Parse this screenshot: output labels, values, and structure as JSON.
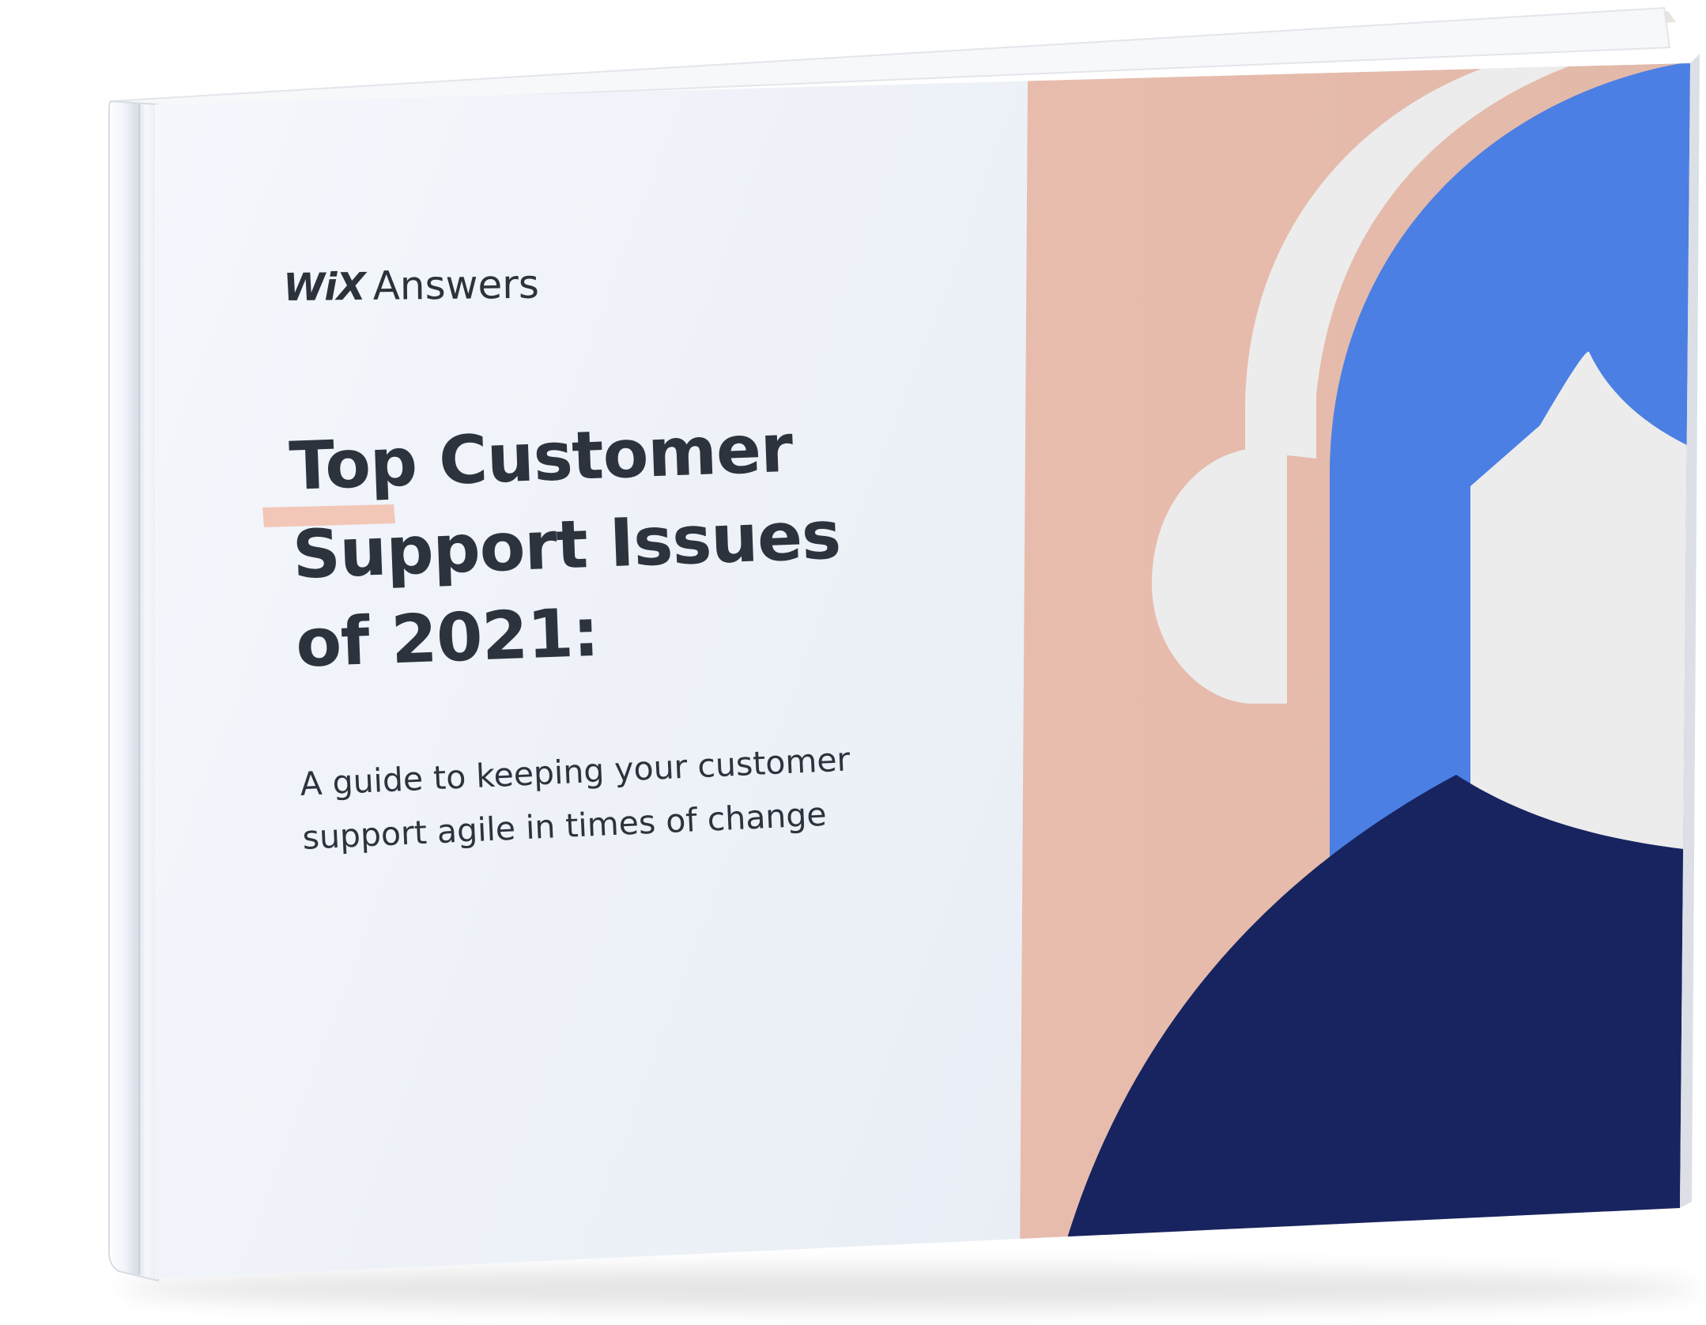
{
  "book": {
    "logo_brand": "WiX",
    "logo_product": "Answers",
    "title_lines": [
      "Top Customer",
      "Support Issues",
      "of 2021:"
    ],
    "subtitle_lines": [
      "A guide to keeping your customer",
      "support agile in times of change"
    ]
  },
  "colors": {
    "cover_background": "#eaf0f9",
    "peach_panel": "#e5bcad",
    "accent_underline": "#f2c2b0",
    "blue_shape": "#4b7fe3",
    "navy_shape": "#172460",
    "light_gray_shape": "#ececec",
    "text_dark": "#2c333d"
  }
}
